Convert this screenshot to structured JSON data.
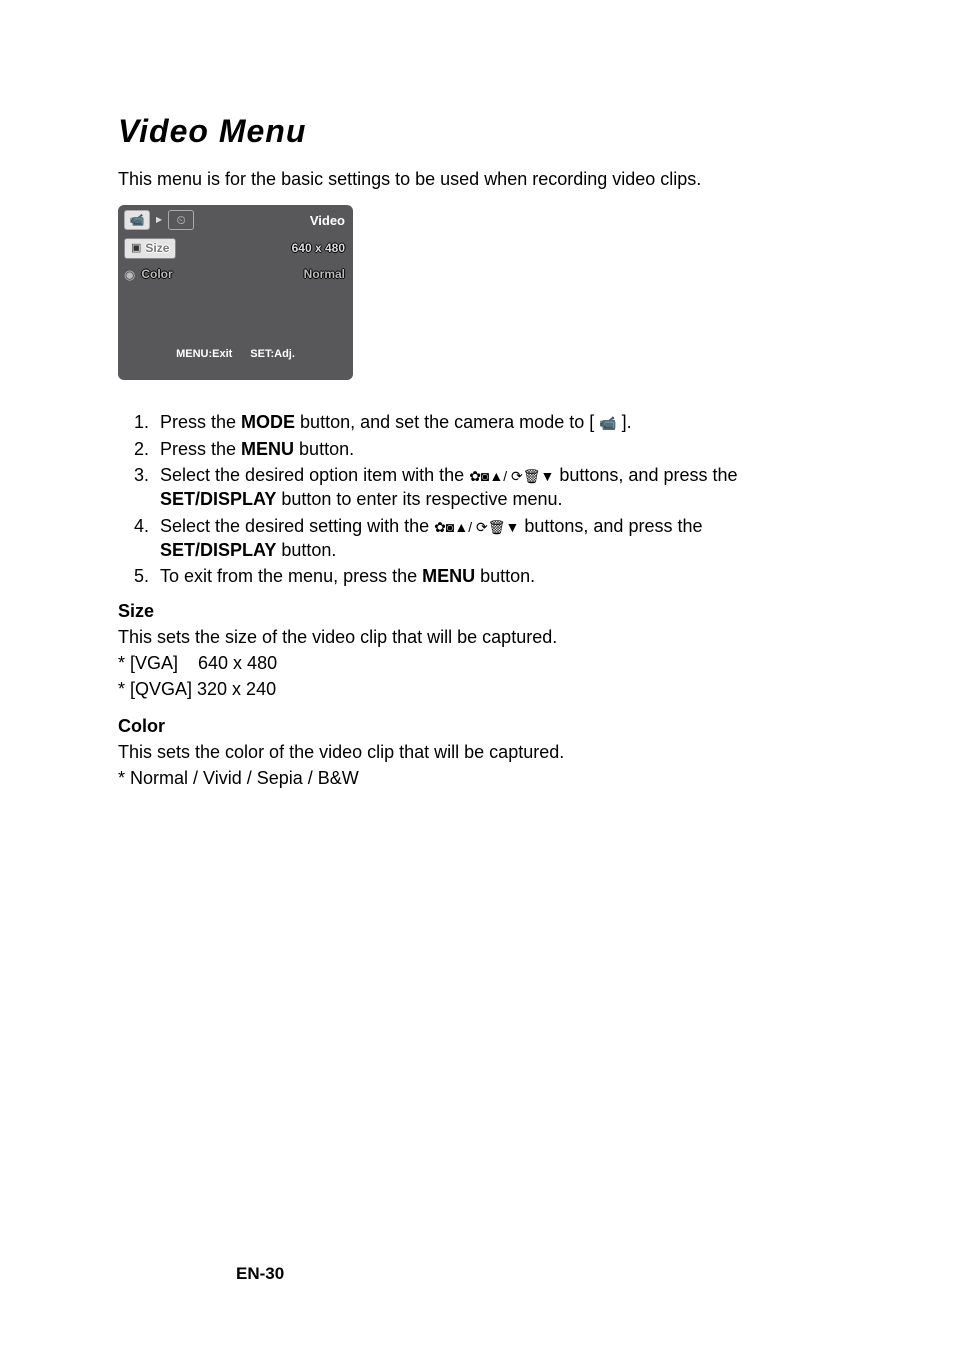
{
  "title": "Video Menu",
  "intro": "This menu is for the basic settings to be used when recording video clips.",
  "lcd": {
    "tab_cam_icon": "📹",
    "tab_arrow": "▶",
    "tab_b_icon": "⏲",
    "title": "Video",
    "rows": [
      {
        "icon": "▣",
        "label": "Size",
        "value": "640 x 480"
      },
      {
        "icon": "◉",
        "label": "Color",
        "value": "Normal"
      }
    ],
    "bottom_left": "MENU:Exit",
    "bottom_right": "SET:Adj."
  },
  "steps": [
    {
      "pre": "Press the ",
      "b": "MODE",
      "post": " button, and set the camera mode to [ ",
      "icon": "📹",
      "end": " ]."
    },
    {
      "pre": "Press the ",
      "b": "MENU",
      "post": " button."
    },
    {
      "pre": "Select the desired option item with the  ",
      "icons": "✿◙▲/ ⟳🗑▼",
      "post": " buttons, and press the ",
      "b2": "SET/DISPLAY",
      "post2": " button to enter its respective menu."
    },
    {
      "pre": "Select the desired setting with the  ",
      "icons": "✿◙▲/ ⟳🗑▼",
      "post": " buttons, and press the ",
      "b2": "SET/DISPLAY",
      "post2": " button."
    },
    {
      "pre": "To exit from the menu, press the ",
      "b": "MENU",
      "post": " button."
    }
  ],
  "size": {
    "title": "Size",
    "desc": "This sets the size of the video clip that will be captured.",
    "opt1": "* [VGA]    640 x 480",
    "opt2": "* [QVGA] 320 x 240"
  },
  "color": {
    "title": "Color",
    "desc": "This sets the color of the video clip that will be captured.",
    "opts": "* Normal / Vivid / Sepia / B&W"
  },
  "footer": "EN-30"
}
